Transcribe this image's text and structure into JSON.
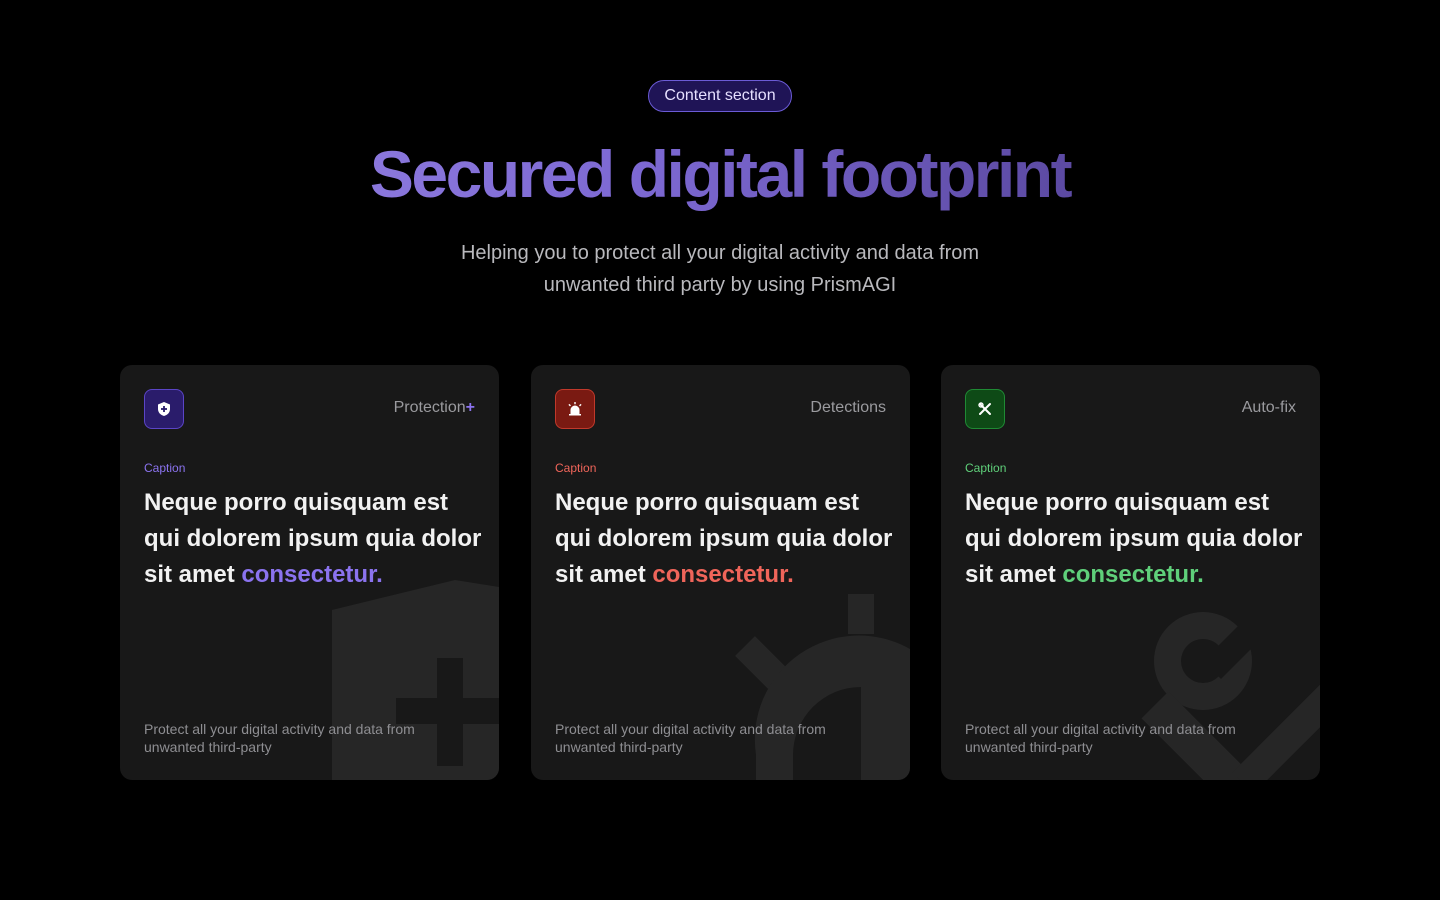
{
  "header": {
    "badge": "Content section",
    "title": "Secured digital footprint",
    "subtitle": "Helping you to protect all your digital activity and data from unwanted third party by using PrismAGI"
  },
  "cards": [
    {
      "tag": "Protection",
      "tag_suffix": "+",
      "caption": "Caption",
      "headline": "Neque porro quisquam est qui dolorem ipsum quia dolor sit amet ",
      "highlight": "consectetur.",
      "description": "Protect all your digital activity and data from unwanted third-party",
      "accent": "#8b73ef",
      "icon": "shield-plus-icon"
    },
    {
      "tag": "Detections",
      "caption": "Caption",
      "headline": "Neque porro quisquam est qui dolorem ipsum quia dolor sit amet ",
      "highlight": "consectetur.",
      "description": "Protect all your digital activity and data from unwanted third-party",
      "accent": "#f0655a",
      "icon": "siren-icon"
    },
    {
      "tag": "Auto-fix",
      "caption": "Caption",
      "headline": "Neque porro quisquam est qui dolorem ipsum quia dolor sit amet ",
      "highlight": "consectetur.",
      "description": "Protect all your digital activity and data from unwanted third-party",
      "accent": "#5fd07a",
      "icon": "tools-icon"
    }
  ]
}
